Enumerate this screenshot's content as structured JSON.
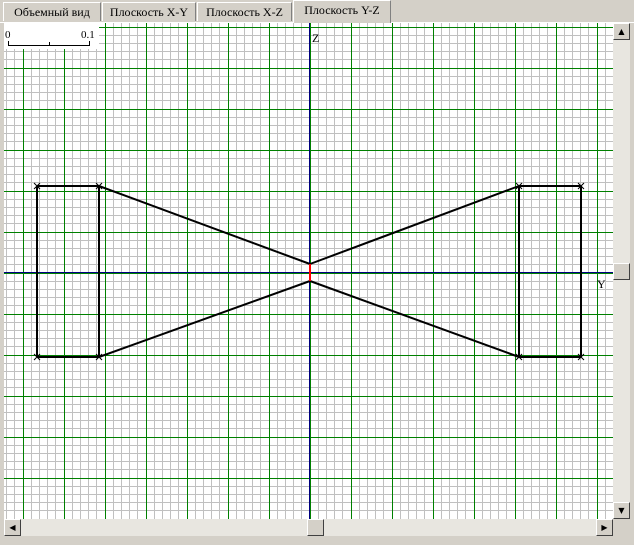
{
  "tabs": [
    {
      "label": "Объемный вид",
      "active": false
    },
    {
      "label": "Плоскость X-Y",
      "active": false
    },
    {
      "label": "Плоскость X-Z",
      "active": false
    },
    {
      "label": "Плоскость Y-Z",
      "active": true
    }
  ],
  "viewport": {
    "axis_z_label": "Z",
    "axis_y_label": "Y",
    "scale_start": "0",
    "scale_end": "0.1",
    "colors": {
      "background": "#ffffff",
      "minor_grid": "#c0c0c0",
      "major_grid": "#008000",
      "axis": "#000080",
      "edge": "#000000",
      "highlight_edge": "#ff0000"
    }
  },
  "icons": {
    "scroll_up": "arrow-up-icon",
    "scroll_down": "arrow-down-icon",
    "scroll_left": "arrow-left-icon",
    "scroll_right": "arrow-right-icon"
  }
}
